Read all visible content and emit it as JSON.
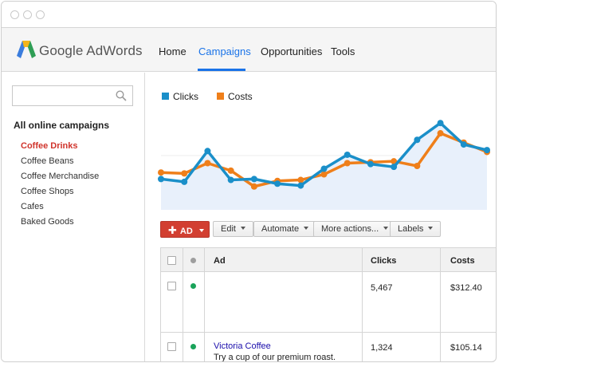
{
  "brand": {
    "name": "Google AdWords"
  },
  "nav": {
    "items": [
      {
        "label": "Home"
      },
      {
        "label": "Campaigns"
      },
      {
        "label": "Opportunities"
      },
      {
        "label": "Tools"
      }
    ],
    "active": "Campaigns"
  },
  "sidebar": {
    "search_placeholder": "",
    "heading": "All online campaigns",
    "items": [
      {
        "label": "Coffee Drinks"
      },
      {
        "label": "Coffee Beans"
      },
      {
        "label": "Coffee Merchandise"
      },
      {
        "label": "Coffee Shops"
      },
      {
        "label": "Cafes"
      },
      {
        "label": "Baked Goods"
      }
    ],
    "active": "Coffee Drinks"
  },
  "chart_data": {
    "type": "line",
    "series": [
      {
        "name": "Clicks",
        "color": "#1a8fc9",
        "values": [
          33,
          30,
          63,
          32,
          33,
          28,
          26,
          44,
          59,
          49,
          46,
          75,
          93,
          70,
          64
        ]
      },
      {
        "name": "Costs",
        "color": "#ef7f1a",
        "values": [
          40,
          39,
          50,
          42,
          25,
          31,
          32,
          38,
          50,
          51,
          52,
          47,
          82,
          72,
          62
        ]
      }
    ],
    "grid": false,
    "legend_position": "top-left",
    "fill_color": "#e8f0fb"
  },
  "toolbar": {
    "add_label": "AD",
    "edit_label": "Edit",
    "automate_label": "Automate",
    "more_label": "More actions...",
    "labels_label": "Labels"
  },
  "table": {
    "columns": {
      "ad": "Ad",
      "clicks": "Clicks",
      "costs": "Costs"
    },
    "header_status_color": "#9e9e9e",
    "rows": [
      {
        "title": "",
        "description": "",
        "clicks": "5,467",
        "costs": "$312.40",
        "status_color": "#1aa35a"
      },
      {
        "title": "Victoria Coffee",
        "description": "Try a cup of our premium roast.",
        "clicks": "1,324",
        "costs": "$105.14",
        "status_color": "#1aa35a"
      }
    ]
  }
}
